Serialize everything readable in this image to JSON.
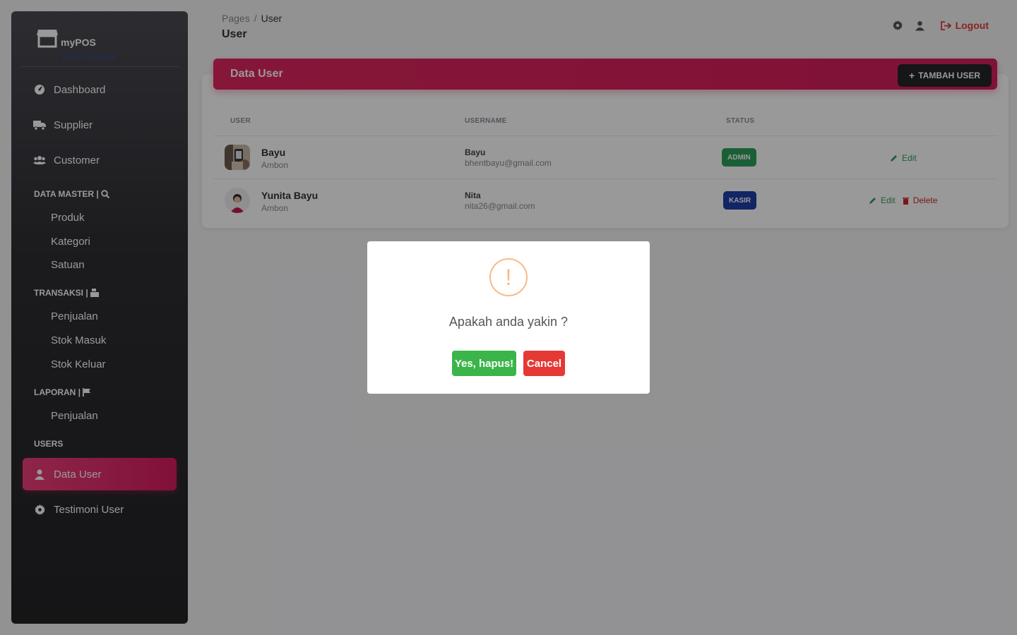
{
  "brand": {
    "name": "myPOS",
    "subtitle": "Point Of Sale"
  },
  "sidebar": {
    "top_items": [
      {
        "label": "Dashboard",
        "icon": "dashboard-icon"
      },
      {
        "label": "Supplier",
        "icon": "truck-icon"
      },
      {
        "label": "Customer",
        "icon": "users-icon"
      }
    ],
    "sections": {
      "data_master": "DATA MASTER |",
      "transaksi": "TRANSAKSI |",
      "laporan": "LAPORAN |",
      "users": "USERS"
    },
    "data_master_items": [
      "Produk",
      "Kategori",
      "Satuan"
    ],
    "transaksi_items": [
      "Penjualan",
      "Stok Masuk",
      "Stok Keluar"
    ],
    "laporan_items": [
      "Penjualan"
    ],
    "users_items": [
      {
        "label": "Data User",
        "icon": "user-icon",
        "active": true
      },
      {
        "label": "Testimoni User",
        "icon": "gear-icon",
        "active": false
      }
    ]
  },
  "header": {
    "breadcrumb": [
      "Pages",
      "/",
      "User"
    ],
    "title": "User",
    "logout_label": "Logout"
  },
  "card": {
    "title": "Data User",
    "add_button_label": "TAMBAH USER",
    "columns": [
      "USER",
      "USERNAME",
      "STATUS"
    ],
    "rows": [
      {
        "name": "Bayu",
        "city": "Ambon",
        "username": "Bayu",
        "email": "bhentbayu@gmail.com",
        "status": "ADMIN",
        "status_color": "#2e9e5b",
        "actions": [
          "Edit"
        ]
      },
      {
        "name": "Yunita Bayu",
        "city": "Ambon",
        "username": "Nita",
        "email": "nita26@gmail.com",
        "status": "KASIR",
        "status_color": "#1e3fa8",
        "actions": [
          "Edit",
          "Delete"
        ]
      }
    ]
  },
  "dialog": {
    "icon": "!",
    "message": "Apakah anda yakin ?",
    "confirm_label": "Yes, hapus!",
    "cancel_label": "Cancel"
  },
  "colors": {
    "accent": "#e91e63",
    "success": "#3bb54a",
    "danger": "#e53935",
    "warning": "#f8bb86"
  }
}
